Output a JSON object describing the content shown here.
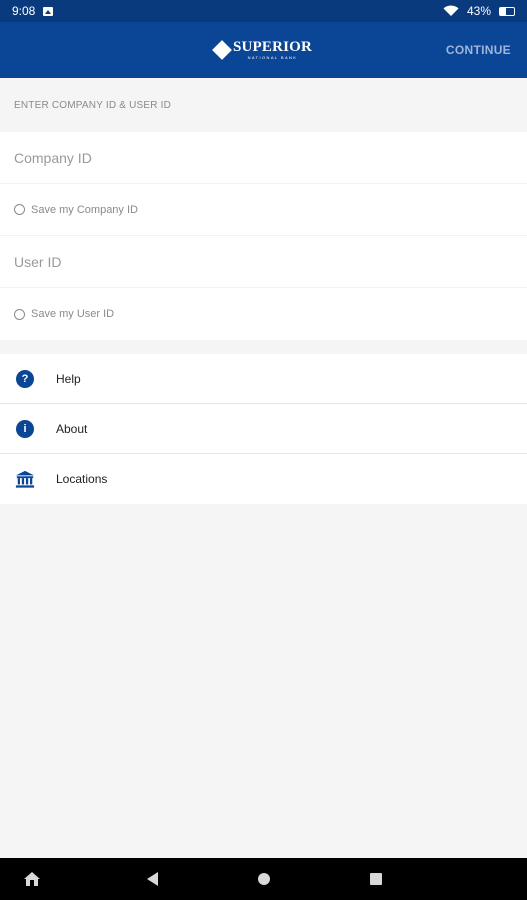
{
  "status_bar": {
    "time": "9:08",
    "battery": "43%"
  },
  "app_bar": {
    "logo_main": "SUPERIOR",
    "logo_sub": "NATIONAL BANK",
    "continue_label": "CONTINUE"
  },
  "form": {
    "section_title": "ENTER COMPANY ID & USER ID",
    "company_id_placeholder": "Company ID",
    "save_company_label": "Save my Company ID",
    "user_id_placeholder": "User ID",
    "save_user_label": "Save my User ID"
  },
  "menu": {
    "items": [
      {
        "label": "Help",
        "icon": "help-icon"
      },
      {
        "label": "About",
        "icon": "info-icon"
      },
      {
        "label": "Locations",
        "icon": "bank-icon"
      }
    ]
  },
  "colors": {
    "primary": "#0b4596",
    "status_bar": "#0a3a7e"
  }
}
